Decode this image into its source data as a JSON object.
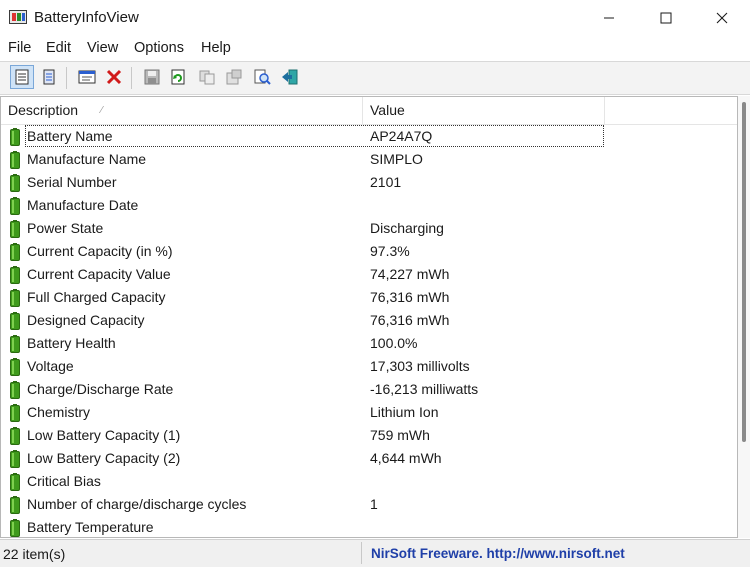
{
  "window": {
    "title": "BatteryInfoView"
  },
  "menu": [
    "File",
    "Edit",
    "View",
    "Options",
    "Help"
  ],
  "toolbar": {
    "icons": [
      "list-view-icon",
      "report-view-icon",
      "properties-icon",
      "delete-icon",
      "save-icon",
      "refresh-icon",
      "copy-icon",
      "options-icon",
      "find-icon",
      "exit-icon"
    ]
  },
  "table": {
    "columns": [
      "Description",
      "Value"
    ],
    "rows": [
      {
        "description": "Battery Name",
        "value": "AP24A7Q"
      },
      {
        "description": "Manufacture Name",
        "value": "SIMPLO"
      },
      {
        "description": "Serial Number",
        "value": "2101"
      },
      {
        "description": "Manufacture Date",
        "value": ""
      },
      {
        "description": "Power State",
        "value": "Discharging"
      },
      {
        "description": "Current Capacity (in %)",
        "value": "97.3%"
      },
      {
        "description": "Current Capacity Value",
        "value": "74,227 mWh"
      },
      {
        "description": "Full Charged Capacity",
        "value": "76,316 mWh"
      },
      {
        "description": "Designed Capacity",
        "value": "76,316 mWh"
      },
      {
        "description": "Battery Health",
        "value": "100.0%"
      },
      {
        "description": "Voltage",
        "value": "17,303 millivolts"
      },
      {
        "description": "Charge/Discharge Rate",
        "value": "-16,213 milliwatts"
      },
      {
        "description": "Chemistry",
        "value": "Lithium Ion"
      },
      {
        "description": "Low Battery Capacity (1)",
        "value": "759 mWh"
      },
      {
        "description": "Low Battery Capacity (2)",
        "value": "4,644 mWh"
      },
      {
        "description": "Critical Bias",
        "value": ""
      },
      {
        "description": "Number of charge/discharge cycles",
        "value": "1"
      },
      {
        "description": "Battery Temperature",
        "value": ""
      }
    ]
  },
  "status": {
    "item_count": "22 item(s)",
    "credit": "NirSoft Freeware.  http://www.nirsoft.net"
  },
  "colors": {
    "battery_green": "#3f9a1c",
    "link_blue": "#1f3fa8",
    "accent": "#cfe3f7"
  }
}
